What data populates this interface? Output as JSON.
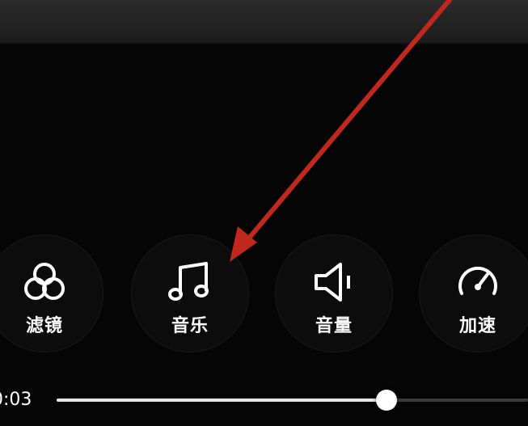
{
  "toolbar": {
    "items": [
      {
        "label": "滤镜",
        "icon": "filter-icon"
      },
      {
        "label": "音乐",
        "icon": "music-note-icon"
      },
      {
        "label": "音量",
        "icon": "speaker-icon"
      },
      {
        "label": "加速",
        "icon": "speedometer-icon"
      }
    ]
  },
  "playback": {
    "time": "0:03",
    "progress": 0.7
  },
  "annotation": {
    "arrow_color": "#c0281e"
  }
}
